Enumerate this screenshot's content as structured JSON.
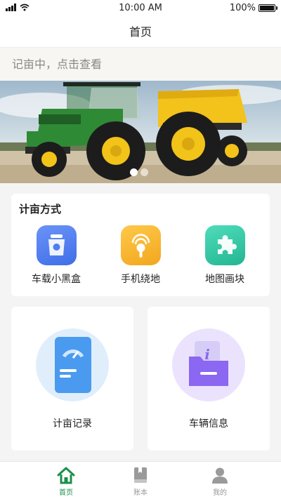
{
  "status_bar": {
    "time": "10:00 AM",
    "battery": "100%",
    "battery_level": 1.0
  },
  "nav": {
    "title": "首页"
  },
  "notice": {
    "text": "记亩中，点击查看"
  },
  "banner": {
    "slides": 2,
    "active_slide": 1
  },
  "methods": {
    "title": "计亩方式",
    "items": [
      {
        "label": "车载小黑盒",
        "icon": "box-icon",
        "color": "#4f7df2"
      },
      {
        "label": "手机绕地",
        "icon": "location-icon",
        "color": "#f5b731"
      },
      {
        "label": "地图画块",
        "icon": "puzzle-icon",
        "color": "#34c7a5"
      }
    ]
  },
  "cards": [
    {
      "label": "计亩记录",
      "icon": "speedometer-document-icon",
      "color": "#4a9bf0"
    },
    {
      "label": "车辆信息",
      "icon": "info-folder-icon",
      "color": "#8b67f2"
    }
  ],
  "tabs": [
    {
      "label": "首页",
      "icon": "home-icon",
      "active": true
    },
    {
      "label": "账本",
      "icon": "ledger-icon",
      "active": false
    },
    {
      "label": "我的",
      "icon": "user-icon",
      "active": false
    }
  ],
  "colors": {
    "accent": "#1c8f4a",
    "background": "#f4f4f4"
  }
}
